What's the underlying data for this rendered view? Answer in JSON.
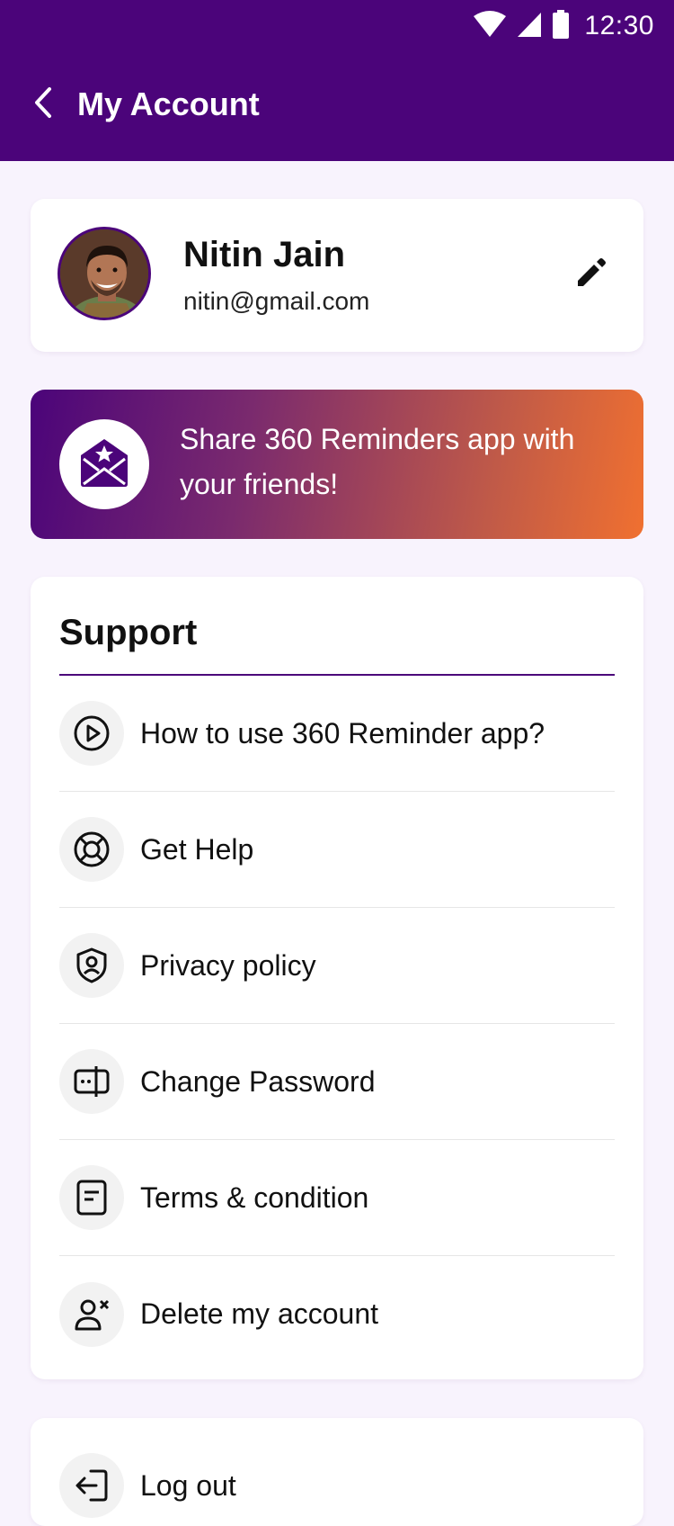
{
  "status_bar": {
    "time": "12:30",
    "icons": [
      "wifi-icon",
      "signal-icon",
      "battery-icon"
    ]
  },
  "app_bar": {
    "title": "My Account",
    "back_icon": "chevron-left-icon"
  },
  "profile": {
    "name": "Nitin Jain",
    "email": "nitin@gmail.com",
    "edit_icon": "pencil-icon"
  },
  "share_banner": {
    "text": "Share 360 Reminders app with your friends!",
    "icon": "envelope-star-icon"
  },
  "support": {
    "title": "Support",
    "items": [
      {
        "label": "How to use 360 Reminder app?",
        "icon": "play-circle-icon"
      },
      {
        "label": "Get Help",
        "icon": "lifebuoy-icon"
      },
      {
        "label": "Privacy policy",
        "icon": "shield-user-icon"
      },
      {
        "label": "Change Password",
        "icon": "password-icon"
      },
      {
        "label": "Terms & condition",
        "icon": "document-icon"
      },
      {
        "label": "Delete my account",
        "icon": "user-remove-icon"
      }
    ]
  },
  "logout": {
    "label": "Log out",
    "icon": "logout-icon"
  },
  "colors": {
    "primary": "#4b047a",
    "background": "#f8f3fd",
    "gradient_end": "#f07030"
  }
}
